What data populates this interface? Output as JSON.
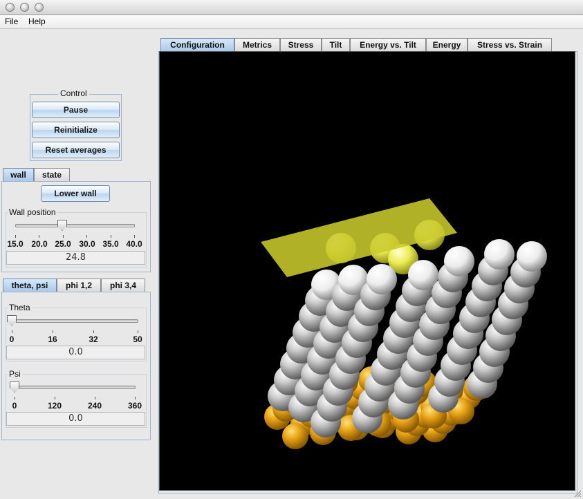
{
  "menubar": {
    "items": [
      "File",
      "Help"
    ]
  },
  "control": {
    "title": "Control",
    "buttons": {
      "pause": "Pause",
      "reinitialize": "Reinitialize",
      "reset_averages": "Reset averages"
    }
  },
  "wall_panel": {
    "tabs": [
      "wall",
      "state"
    ],
    "active_tab": "wall",
    "lower_wall_button": "Lower wall",
    "wall_position": {
      "label": "Wall position",
      "ticks": [
        "15.0",
        "20.0",
        "25.0",
        "30.0",
        "35.0",
        "40.0"
      ],
      "min": 15.0,
      "max": 40.0,
      "value": "24.8"
    }
  },
  "angle_panel": {
    "tabs": [
      "theta, psi",
      "phi 1,2",
      "phi 3,4"
    ],
    "active_tab": "theta, psi",
    "theta": {
      "label": "Theta",
      "ticks": [
        "0",
        "16",
        "32",
        "50"
      ],
      "min": 0,
      "max": 50,
      "value": "0.0"
    },
    "psi": {
      "label": "Psi",
      "ticks": [
        "0",
        "120",
        "240",
        "360"
      ],
      "min": 0,
      "max": 360,
      "value": "0.0"
    }
  },
  "main_tabs": {
    "items": [
      "Configuration",
      "Metrics",
      "Stress",
      "Tilt",
      "Energy vs. Tilt",
      "Energy",
      "Stress vs. Strain"
    ],
    "active": "Configuration"
  },
  "colors": {
    "scene_background": "#000000",
    "wall_plane": "#c9c92e",
    "gold_atom": "#e8a317",
    "chain_atom": "#d0d0d0",
    "tab_active": "#a9c7e8"
  }
}
